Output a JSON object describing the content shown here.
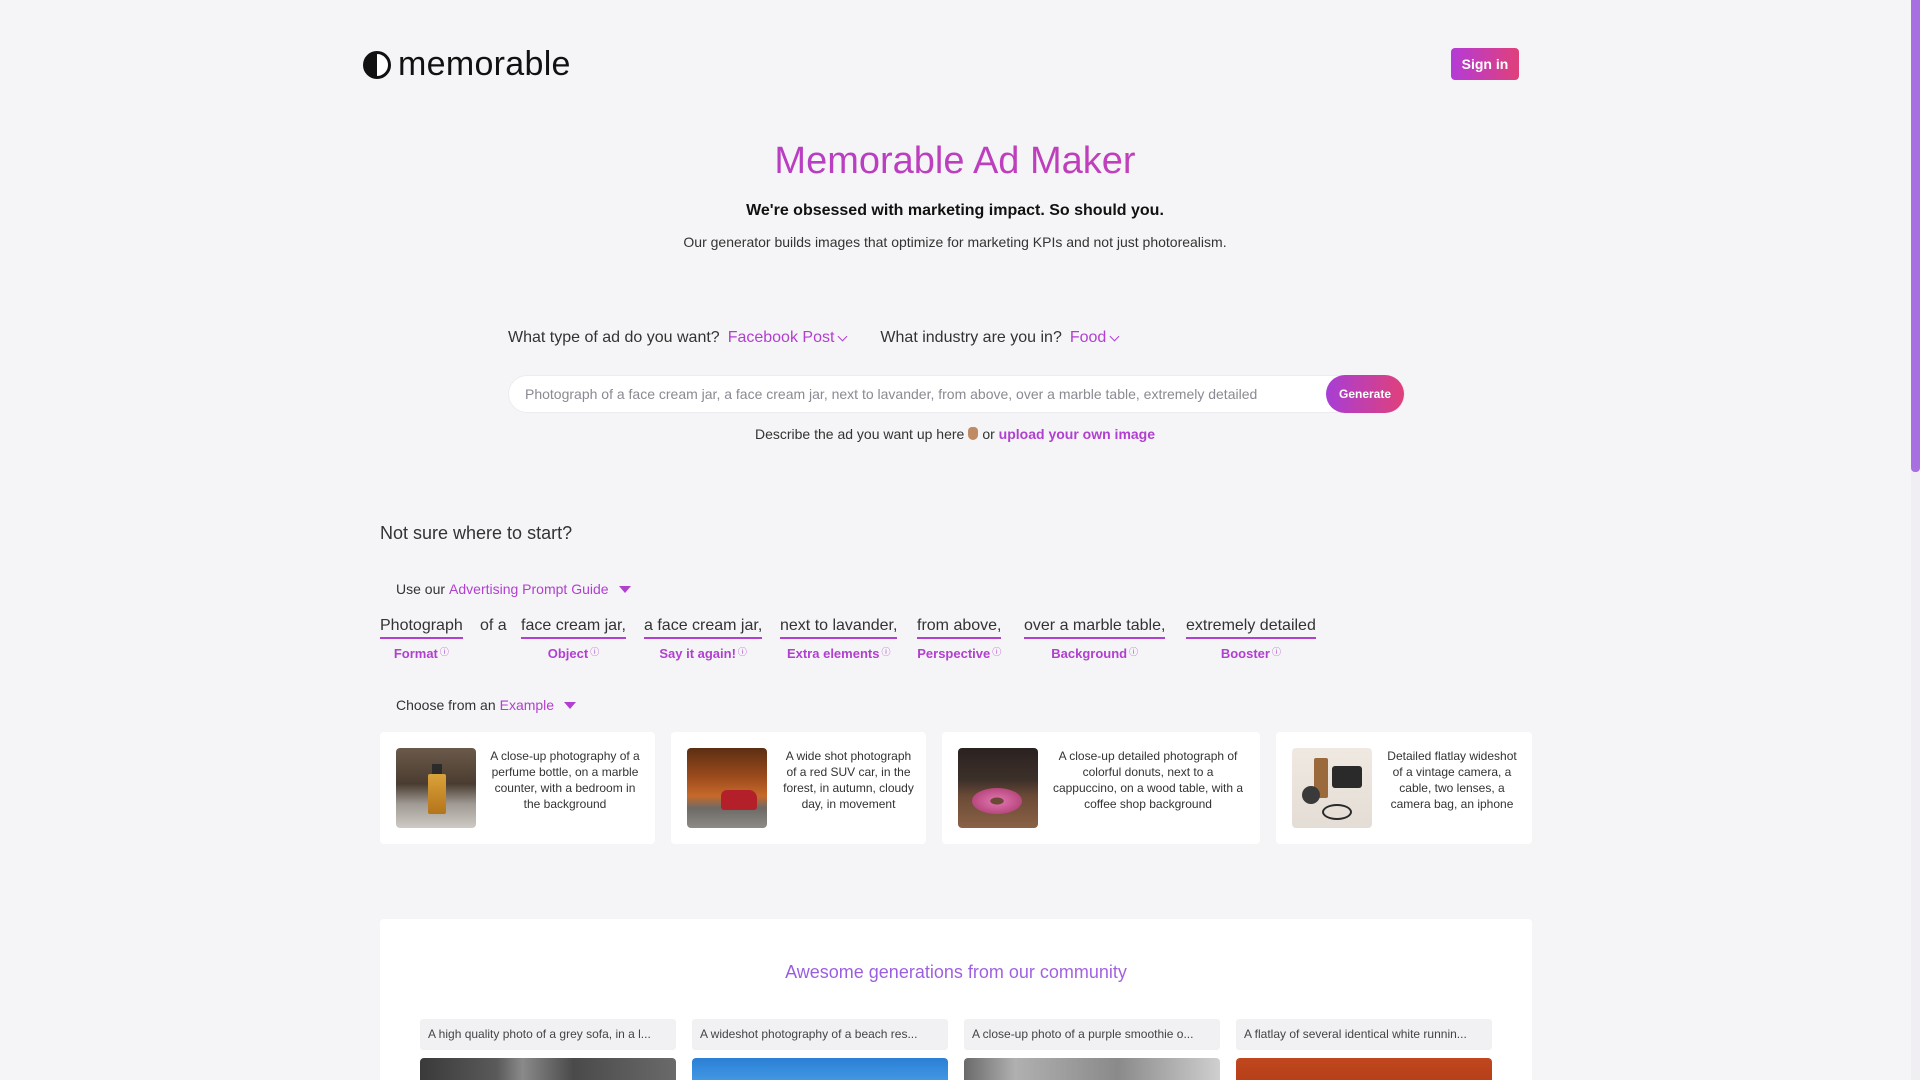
{
  "header": {
    "logo_text": "memorable",
    "sign_in": "Sign in"
  },
  "hero": {
    "title": "Memorable Ad Maker",
    "subtitle": "We're obsessed with marketing impact. So should you.",
    "description": "Our generator builds images that optimize for marketing KPIs and not just photorealism."
  },
  "ad_type": {
    "question": "What type of ad do you want?",
    "selected": "Facebook Post"
  },
  "industry": {
    "question": "What industry are you in?",
    "selected": "Food"
  },
  "prompt": {
    "placeholder": "Photograph of a face cream jar, a face cream jar, next to lavander, from above, over a marble table, extremely detailed",
    "value": "",
    "generate_label": "Generate"
  },
  "describe": {
    "text": "Describe the ad you want up here",
    "or": "or",
    "upload_link": "upload your own image"
  },
  "guide": {
    "heading": "Not sure where to start?",
    "use_our": "Use our",
    "guide_link": "Advertising Prompt Guide",
    "parts": [
      {
        "word": "Photograph",
        "tag": "Format"
      },
      {
        "word": "face cream jar,",
        "tag": "Object"
      },
      {
        "word": "a face cream jar,",
        "tag": "Say it again!"
      },
      {
        "word": "next to lavander,",
        "tag": "Extra elements"
      },
      {
        "word": "from above,",
        "tag": "Perspective"
      },
      {
        "word": "over a marble table,",
        "tag": "Background"
      },
      {
        "word": "extremely detailed",
        "tag": "Booster"
      }
    ],
    "connector": "of a",
    "info_glyph": "ⓘ"
  },
  "examples": {
    "choose_from": "Choose from an",
    "example_link": "Example",
    "cards": [
      {
        "text": "A close-up photography of a perfume bottle, on a marble counter, with a bedroom in the background"
      },
      {
        "text": "A wide shot photograph of a red SUV car, in the forest, in autumn, cloudy day, in movement"
      },
      {
        "text": "A close-up detailed photograph of colorful donuts, next to a cappuccino, on a wood table, with a coffee shop background"
      },
      {
        "text": "Detailed flatlay wideshot of a vintage camera, a cable, two lenses, a camera bag, an iphone"
      }
    ]
  },
  "community": {
    "title": "Awesome generations from our community",
    "items": [
      {
        "caption": "A high quality photo of a grey sofa, in a l..."
      },
      {
        "caption": "A wideshot photography of a beach res..."
      },
      {
        "caption": "A close-up photo of a purple smoothie o..."
      },
      {
        "caption": "A flatlay of several identical white runnin..."
      }
    ]
  },
  "colors": {
    "accent": "#b13fd0",
    "gradient_start": "#a73ed6",
    "gradient_end": "#e0407a",
    "background": "#f5f5f7"
  }
}
